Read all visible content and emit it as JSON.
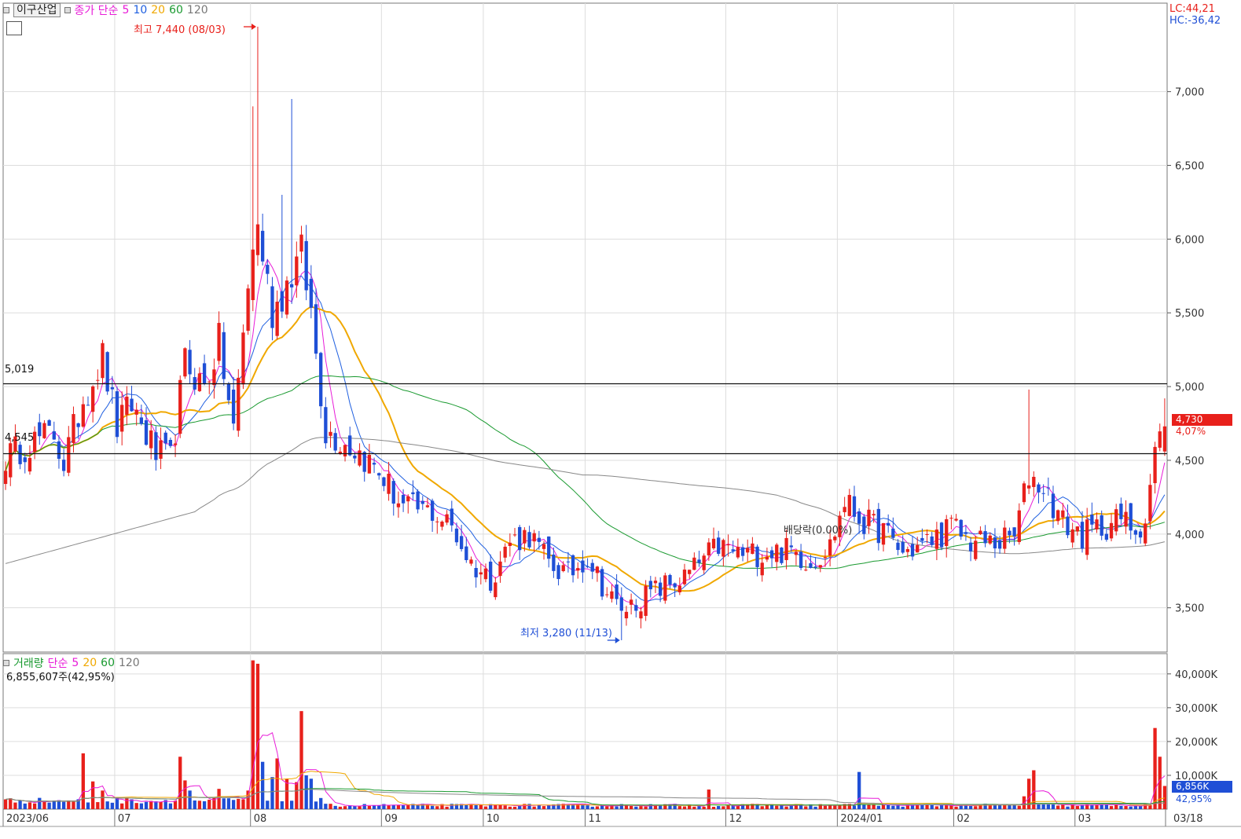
{
  "header": {
    "stock_name": "이구산업",
    "ma_title": "종가 단순",
    "ma_labels": [
      "5",
      "10",
      "20",
      "60",
      "120"
    ],
    "lc_text": "LC:44,21",
    "hc_text": "HC:-36,42"
  },
  "volume_panel": {
    "title": "거래량",
    "ma_title": "단순",
    "ma_labels": [
      "5",
      "20",
      "60",
      "120"
    ],
    "current_text": "6,855,607주(42,95%)",
    "current_badge": "6,856K",
    "current_pct": "42,95%"
  },
  "annotations": {
    "high": "최고 7,440 (08/03)",
    "low": "최저 3,280 (11/13)",
    "dividend": "배당락(0.00%)",
    "line_5019": "5,019",
    "line_4545": "4,545",
    "current_price": "4,730",
    "current_change": "4,07%"
  },
  "colors": {
    "up": "#e8201b",
    "down": "#1f4fd6",
    "ma5": "#e81cd8",
    "ma10": "#2060e0",
    "ma20": "#f0a800",
    "ma60": "#1a9a30",
    "ma120": "#888888"
  },
  "chart_data": {
    "type": "candlestick",
    "y_axis_ticks": [
      "3,500",
      "4,000",
      "4,500",
      "5,000",
      "5,500",
      "6,000",
      "6,500",
      "7,000"
    ],
    "ylim": [
      3200,
      7600
    ],
    "volume_ticks": [
      "10,000K",
      "20,000K",
      "30,000K",
      "40,000K"
    ],
    "volume_ylim": [
      0,
      46000
    ],
    "x_labels": [
      "2023/06",
      "07",
      "08",
      "09",
      "10",
      "11",
      "12",
      "2024/01",
      "02",
      "03",
      "03/18"
    ],
    "horizontal_lines": [
      5019,
      4545
    ],
    "keypoints": [
      {
        "i": 0,
        "p": 4520
      },
      {
        "i": 5,
        "p": 4620
      },
      {
        "i": 10,
        "p": 4680
      },
      {
        "i": 12,
        "p": 4480
      },
      {
        "i": 16,
        "p": 4920
      },
      {
        "i": 20,
        "p": 5200
      },
      {
        "i": 23,
        "p": 4720
      },
      {
        "i": 26,
        "p": 4880
      },
      {
        "i": 31,
        "p": 4540
      },
      {
        "i": 34,
        "p": 4500
      },
      {
        "i": 37,
        "p": 5160
      },
      {
        "i": 41,
        "p": 5000
      },
      {
        "i": 44,
        "p": 5300
      },
      {
        "i": 47,
        "p": 4700
      },
      {
        "i": 50,
        "p": 5700
      },
      {
        "i": 52,
        "p": 6100
      },
      {
        "i": 55,
        "p": 5500
      },
      {
        "i": 58,
        "p": 5700
      },
      {
        "i": 61,
        "p": 5900
      },
      {
        "i": 63,
        "p": 5500
      },
      {
        "i": 66,
        "p": 4700
      },
      {
        "i": 70,
        "p": 4620
      },
      {
        "i": 73,
        "p": 4550
      },
      {
        "i": 77,
        "p": 4420
      },
      {
        "i": 82,
        "p": 4180
      },
      {
        "i": 88,
        "p": 4150
      },
      {
        "i": 92,
        "p": 4050
      },
      {
        "i": 96,
        "p": 3800
      },
      {
        "i": 100,
        "p": 3700
      },
      {
        "i": 104,
        "p": 3950
      },
      {
        "i": 108,
        "p": 4000
      },
      {
        "i": 112,
        "p": 3800
      },
      {
        "i": 116,
        "p": 3720
      },
      {
        "i": 120,
        "p": 3850
      },
      {
        "i": 124,
        "p": 3600
      },
      {
        "i": 127,
        "p": 3480
      },
      {
        "i": 131,
        "p": 3560
      },
      {
        "i": 136,
        "p": 3650
      },
      {
        "i": 140,
        "p": 3700
      },
      {
        "i": 143,
        "p": 3800
      },
      {
        "i": 147,
        "p": 3920
      },
      {
        "i": 152,
        "p": 3860
      },
      {
        "i": 157,
        "p": 3880
      },
      {
        "i": 162,
        "p": 3890
      },
      {
        "i": 166,
        "p": 3810
      },
      {
        "i": 170,
        "p": 3920
      },
      {
        "i": 173,
        "p": 4220
      },
      {
        "i": 177,
        "p": 4080
      },
      {
        "i": 181,
        "p": 4020
      },
      {
        "i": 185,
        "p": 3870
      },
      {
        "i": 190,
        "p": 3940
      },
      {
        "i": 195,
        "p": 4050
      },
      {
        "i": 199,
        "p": 3950
      },
      {
        "i": 204,
        "p": 3940
      },
      {
        "i": 208,
        "p": 3980
      },
      {
        "i": 211,
        "p": 4400
      },
      {
        "i": 214,
        "p": 4320
      },
      {
        "i": 218,
        "p": 4080
      },
      {
        "i": 222,
        "p": 3990
      },
      {
        "i": 226,
        "p": 4050
      },
      {
        "i": 230,
        "p": 4100
      },
      {
        "i": 233,
        "p": 4040
      },
      {
        "i": 235,
        "p": 4100
      },
      {
        "i": 237,
        "p": 4550
      },
      {
        "i": 239,
        "p": 4730
      }
    ],
    "high": {
      "index": 52,
      "value": 7440,
      "date": "08/03"
    },
    "low": {
      "index": 127,
      "value": 3280,
      "date": "11/13"
    },
    "last": {
      "close": 4730,
      "change_pct": 4.07,
      "volume": 6855607
    },
    "volume_spikes": [
      {
        "i": 16,
        "v": 16500
      },
      {
        "i": 18,
        "v": 8200
      },
      {
        "i": 20,
        "v": 5500
      },
      {
        "i": 36,
        "v": 15500
      },
      {
        "i": 37,
        "v": 8500
      },
      {
        "i": 38,
        "v": 5500
      },
      {
        "i": 44,
        "v": 6000
      },
      {
        "i": 50,
        "v": 5500
      },
      {
        "i": 51,
        "v": 44000
      },
      {
        "i": 52,
        "v": 43000
      },
      {
        "i": 53,
        "v": 14000
      },
      {
        "i": 55,
        "v": 9500
      },
      {
        "i": 56,
        "v": 15000
      },
      {
        "i": 58,
        "v": 9000
      },
      {
        "i": 60,
        "v": 8000
      },
      {
        "i": 61,
        "v": 29000
      },
      {
        "i": 62,
        "v": 10000
      },
      {
        "i": 63,
        "v": 9000
      },
      {
        "i": 145,
        "v": 5800
      },
      {
        "i": 176,
        "v": 11000
      },
      {
        "i": 210,
        "v": 3800
      },
      {
        "i": 211,
        "v": 9000
      },
      {
        "i": 212,
        "v": 11500
      },
      {
        "i": 237,
        "v": 24000
      },
      {
        "i": 238,
        "v": 15500
      },
      {
        "i": 239,
        "v": 6856
      }
    ]
  }
}
